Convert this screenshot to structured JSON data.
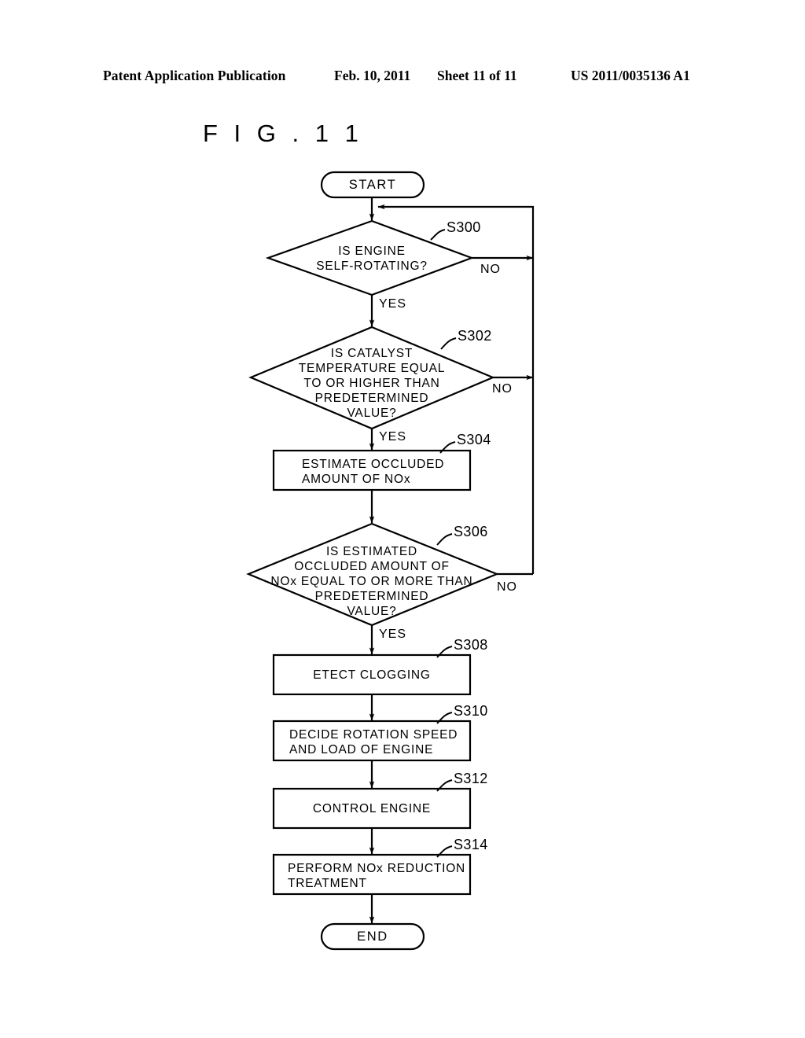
{
  "header": {
    "publication": "Patent Application Publication",
    "date": "Feb. 10, 2011",
    "sheet": "Sheet 11 of 11",
    "number": "US 2011/0035136 A1"
  },
  "figure": {
    "title": "F I G .  1 1"
  },
  "flowchart": {
    "start": {
      "label": "START"
    },
    "end": {
      "label": "END"
    },
    "nodes": [
      {
        "id": "S300",
        "step": "S300",
        "shape": "decision",
        "text": "IS ENGINE\nSELF-ROTATING?",
        "yes": "YES",
        "no": "NO"
      },
      {
        "id": "S302",
        "step": "S302",
        "shape": "decision",
        "text": "IS CATALYST\nTEMPERATURE EQUAL\nTO OR HIGHER THAN\nPREDETERMINED\nVALUE?",
        "yes": "YES",
        "no": "NO"
      },
      {
        "id": "S304",
        "step": "S304",
        "shape": "process",
        "text": "ESTIMATE OCCLUDED\nAMOUNT OF NOx"
      },
      {
        "id": "S306",
        "step": "S306",
        "shape": "decision",
        "text": "IS ESTIMATED\nOCCLUDED AMOUNT OF\nNOx EQUAL TO OR MORE THAN\nPREDETERMINED\nVALUE?",
        "yes": "YES",
        "no": "NO"
      },
      {
        "id": "S308",
        "step": "S308",
        "shape": "process",
        "text": "ETECT CLOGGING"
      },
      {
        "id": "S310",
        "step": "S310",
        "shape": "process",
        "text": "DECIDE ROTATION SPEED\nAND LOAD OF ENGINE"
      },
      {
        "id": "S312",
        "step": "S312",
        "shape": "process",
        "text": "CONTROL ENGINE"
      },
      {
        "id": "S314",
        "step": "S314",
        "shape": "process",
        "text": "PERFORM NOx REDUCTION\nTREATMENT"
      }
    ]
  },
  "chart_data": {
    "type": "diagram",
    "title": "F I G .  1 1",
    "diagram_kind": "flowchart",
    "sequence": [
      "START",
      "S300",
      "S302",
      "S304",
      "S306",
      "S308",
      "S310",
      "S312",
      "S314",
      "END"
    ],
    "edges": [
      {
        "from": "START",
        "to": "S300",
        "label": ""
      },
      {
        "from": "S300",
        "to": "S302",
        "label": "YES"
      },
      {
        "from": "S300",
        "to": "START",
        "label": "NO"
      },
      {
        "from": "S302",
        "to": "S304",
        "label": "YES"
      },
      {
        "from": "S302",
        "to": "START",
        "label": "NO"
      },
      {
        "from": "S304",
        "to": "S306",
        "label": ""
      },
      {
        "from": "S306",
        "to": "S308",
        "label": "YES"
      },
      {
        "from": "S306",
        "to": "START",
        "label": "NO"
      },
      {
        "from": "S308",
        "to": "S310",
        "label": ""
      },
      {
        "from": "S310",
        "to": "S312",
        "label": ""
      },
      {
        "from": "S312",
        "to": "S314",
        "label": ""
      },
      {
        "from": "S314",
        "to": "END",
        "label": ""
      }
    ]
  }
}
